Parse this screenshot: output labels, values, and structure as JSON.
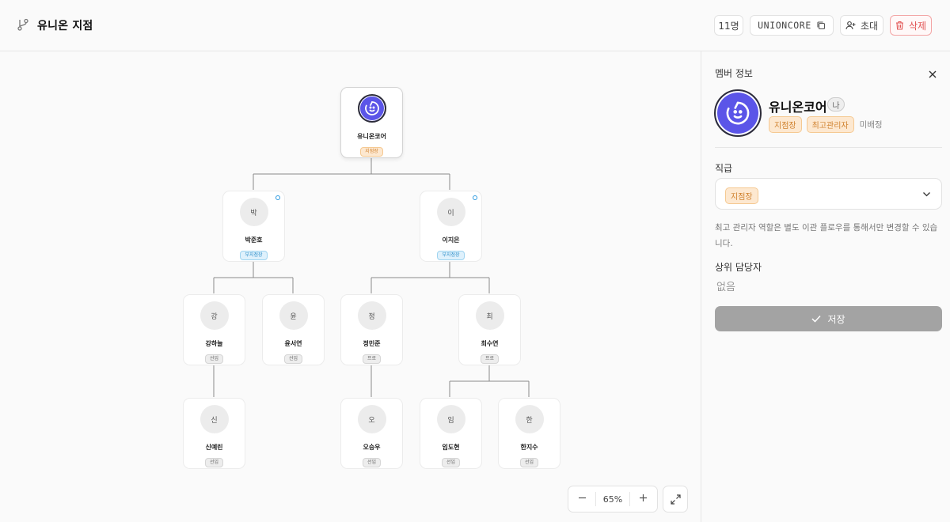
{
  "header": {
    "title": "유니온 지점",
    "member_count": "11명",
    "invite_code": "UNIONCORE",
    "invite_label": "초대",
    "delete_label": "삭제"
  },
  "org": {
    "root": {
      "name": "유니온코어",
      "role": "지점장"
    },
    "managers": [
      {
        "initial": "박",
        "name": "박준호",
        "role": "부지점장"
      },
      {
        "initial": "이",
        "name": "이지은",
        "role": "부지점장"
      }
    ],
    "pros": [
      {
        "initial": "강",
        "name": "강하늘",
        "role": "선임"
      },
      {
        "initial": "윤",
        "name": "윤서연",
        "role": "선임"
      },
      {
        "initial": "정",
        "name": "정민준",
        "role": "프로"
      },
      {
        "initial": "최",
        "name": "최수연",
        "role": "프로"
      }
    ],
    "members": [
      {
        "initial": "신",
        "name": "신예린",
        "role": "선임"
      },
      {
        "initial": "오",
        "name": "오승우",
        "role": "선임"
      },
      {
        "initial": "임",
        "name": "임도현",
        "role": "선임"
      },
      {
        "initial": "한",
        "name": "한지수",
        "role": "선임"
      }
    ]
  },
  "zoom": {
    "level": "65%"
  },
  "panel": {
    "title": "멤버 정보",
    "name": "유니온코어",
    "me_badge": "나",
    "tags": [
      "지점장",
      "최고관리자"
    ],
    "unassigned": "미배정",
    "position_label": "직급",
    "position_value": "지점장",
    "hint": "최고 관리자 역할은 별도 이관 플로우를 통해서만 변경할 수 있습니다.",
    "supervisor_label": "상위 담당자",
    "supervisor_value": "없음",
    "save_label": "저장"
  },
  "colors": {
    "accent": "#5b55e8",
    "head_badge": "#d0822f",
    "sub_badge": "#2e8fc9",
    "danger": "#e25555"
  }
}
